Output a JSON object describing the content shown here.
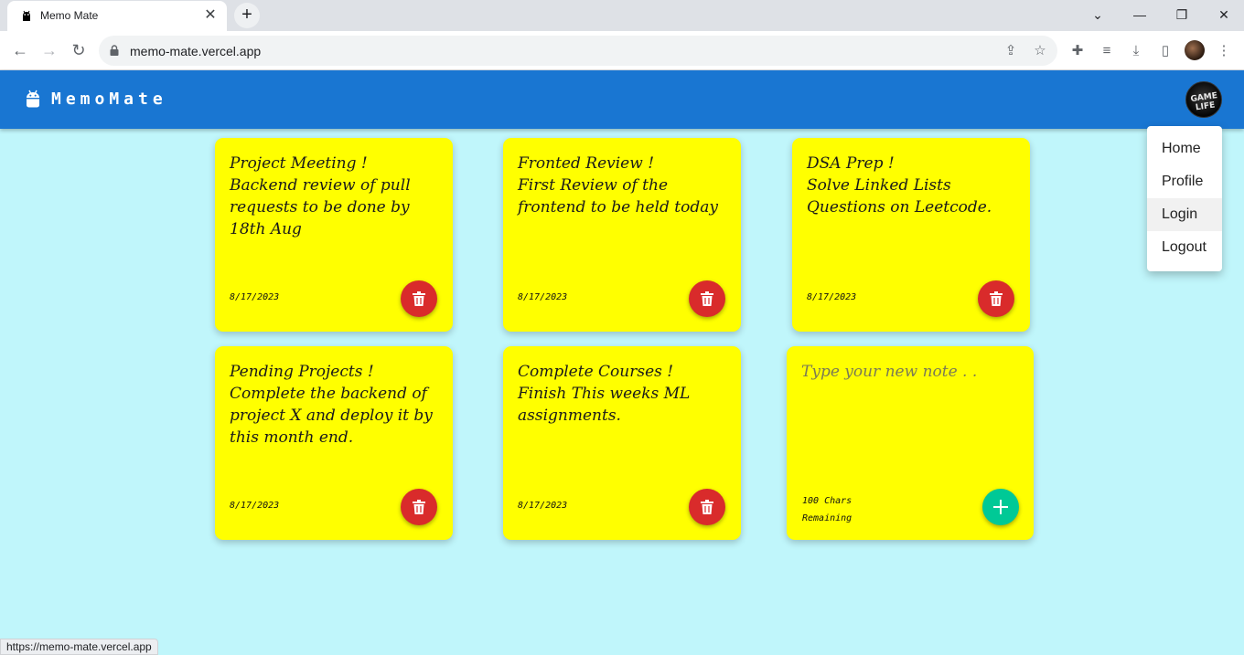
{
  "browser": {
    "tab_title": "Memo Mate",
    "url": "memo-mate.vercel.app",
    "status_url": "https://memo-mate.vercel.app"
  },
  "app": {
    "brand": "MemoMate",
    "avatar_text": "GAME LIFE",
    "menu": [
      "Home",
      "Profile",
      "Login",
      "Logout"
    ]
  },
  "notes": [
    {
      "title": "Project Meeting !",
      "body": "Backend review of pull requests to be done by 18th Aug",
      "date": "8/17/2023"
    },
    {
      "title": "Fronted Review !",
      "body": "First Review of the frontend to be held today",
      "date": "8/17/2023"
    },
    {
      "title": "DSA Prep !",
      "body": "Solve Linked Lists Questions on Leetcode.",
      "date": "8/17/2023"
    },
    {
      "title": "Pending Projects !",
      "body": "Complete the backend of project X and deploy it by this month end.",
      "date": "8/17/2023"
    },
    {
      "title": "Complete Courses !",
      "body": "Finish This weeks ML assignments.",
      "date": "8/17/2023"
    }
  ],
  "new_note": {
    "placeholder": "Type your new note . .",
    "remaining": "100 Chars Remaining"
  },
  "colors": {
    "appbar": "#1976d2",
    "background": "#c0f6fb",
    "note": "#ffff00",
    "delete": "#d92b2b",
    "add": "#00c996"
  },
  "icons": {
    "brand": "android-icon",
    "delete": "trash-icon",
    "add": "plus-icon"
  }
}
